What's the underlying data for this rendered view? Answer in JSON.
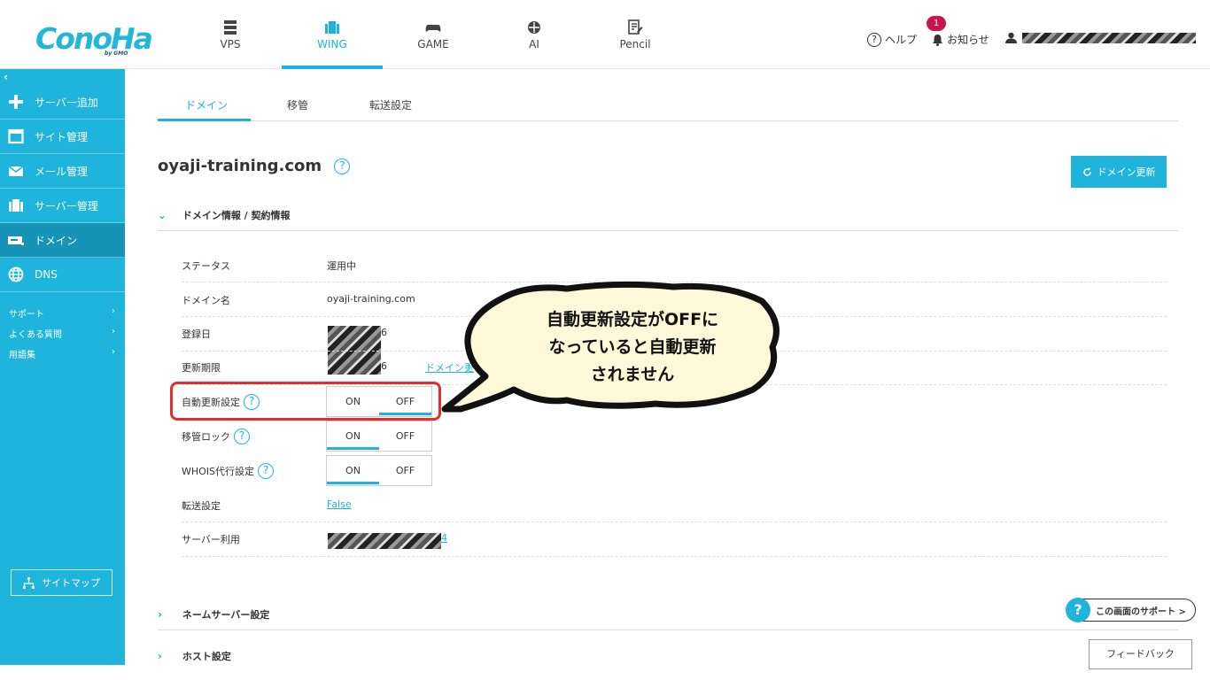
{
  "header": {
    "logo_text": "ConoHa",
    "logo_sub": "by GMO",
    "tabs": [
      {
        "label": "VPS",
        "icon": "server-icon"
      },
      {
        "label": "WING",
        "icon": "wing-icon",
        "active": true
      },
      {
        "label": "GAME",
        "icon": "gamepad-icon"
      },
      {
        "label": "AI",
        "icon": "ai-icon"
      },
      {
        "label": "Pencil",
        "icon": "pencil-icon"
      }
    ],
    "help_label": "ヘルプ",
    "notice_label": "お知らせ",
    "notice_count": "1"
  },
  "sidebar": {
    "collapse_icon": "‹",
    "items": [
      {
        "label": "サーバー追加",
        "icon": "plus-icon"
      },
      {
        "label": "サイト管理",
        "icon": "window-icon"
      },
      {
        "label": "メール管理",
        "icon": "mail-icon"
      },
      {
        "label": "サーバー管理",
        "icon": "server-icon"
      },
      {
        "label": "ドメイン",
        "icon": "domain-icon",
        "active": true
      },
      {
        "label": "DNS",
        "icon": "globe-icon"
      }
    ],
    "links": [
      {
        "label": "サポート"
      },
      {
        "label": "よくある質問"
      },
      {
        "label": "用語集"
      }
    ],
    "sitemap_label": "サイトマップ"
  },
  "subtabs": [
    {
      "label": "ドメイン",
      "active": true
    },
    {
      "label": "移管"
    },
    {
      "label": "転送設定"
    }
  ],
  "main": {
    "domain_title": "oyaji-training.com",
    "help_icon": "?",
    "renew_label": "ドメイン更新",
    "section_info": "ドメイン情報 / 契約情報",
    "rows": [
      {
        "label": "ステータス",
        "value": "運用中"
      },
      {
        "label": "ドメイン名",
        "value": "oyaji-training.com"
      },
      {
        "label": "登録日",
        "value": "6"
      },
      {
        "label": "更新期限",
        "value": "6",
        "link": "ドメイン更"
      },
      {
        "label": "自動更新設定",
        "on": "ON",
        "off": "OFF",
        "selected": "OFF"
      },
      {
        "label": "移管ロック",
        "on": "ON",
        "off": "OFF",
        "selected": "ON"
      },
      {
        "label": "WHOIS代行設定",
        "on": "ON",
        "off": "OFF",
        "selected": "ON"
      },
      {
        "label": "転送設定",
        "value": "False"
      },
      {
        "label": "サーバー利用",
        "value": "4"
      }
    ],
    "section_ns": "ネームサーバー設定",
    "section_host": "ホスト設定"
  },
  "callout": {
    "line1": "自動更新設定がOFFに",
    "line2": "なっていると自動更新",
    "line3": "されません"
  },
  "support_label": "この画面のサポート >",
  "feedback_label": "フィードバック",
  "colors": {
    "accent": "#1cb4d9",
    "sidebar": "#1eb4db",
    "sidebar_active": "#1694b7",
    "highlight": "#e62c2c",
    "callout_fill": "#fdf8d8"
  }
}
